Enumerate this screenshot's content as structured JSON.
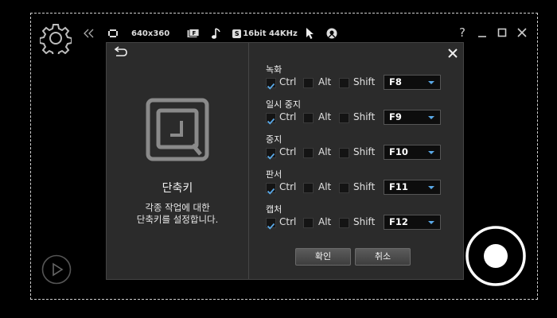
{
  "toolbar": {
    "resolution": "640x360",
    "audio_format": "16bit 44KHz"
  },
  "dialog": {
    "title": "단축키",
    "description": "각종 작업에 대한\n단축키를 설정합니다.",
    "modifier_labels": {
      "ctrl": "Ctrl",
      "alt": "Alt",
      "shift": "Shift"
    },
    "shortcuts": [
      {
        "label": "녹화",
        "ctrl": true,
        "alt": false,
        "shift": false,
        "key": "F8"
      },
      {
        "label": "일시 중지",
        "ctrl": true,
        "alt": false,
        "shift": false,
        "key": "F9"
      },
      {
        "label": "중지",
        "ctrl": true,
        "alt": false,
        "shift": false,
        "key": "F10"
      },
      {
        "label": "판서",
        "ctrl": true,
        "alt": false,
        "shift": false,
        "key": "F11"
      },
      {
        "label": "캡처",
        "ctrl": true,
        "alt": false,
        "shift": false,
        "key": "F12"
      }
    ],
    "ok_label": "확인",
    "cancel_label": "취소"
  },
  "window_controls": {
    "help": "?"
  },
  "icons": {
    "settings": "gear-icon",
    "collapse": "double-chevron-left-icon",
    "video": "film-icon",
    "format": "f-icon",
    "audio": "music-note-icon",
    "audio_quality": "s-badge-icon",
    "cursor": "cursor-icon",
    "webcam": "webcam-icon",
    "back": "back-arrow-icon",
    "close": "close-icon",
    "shortcut": "keyboard-key-icon",
    "play": "play-icon",
    "record": "record-icon"
  },
  "colors": {
    "accent": "#5aa9e8",
    "dialog_bg": "#2b2b2b",
    "background": "#000000"
  }
}
